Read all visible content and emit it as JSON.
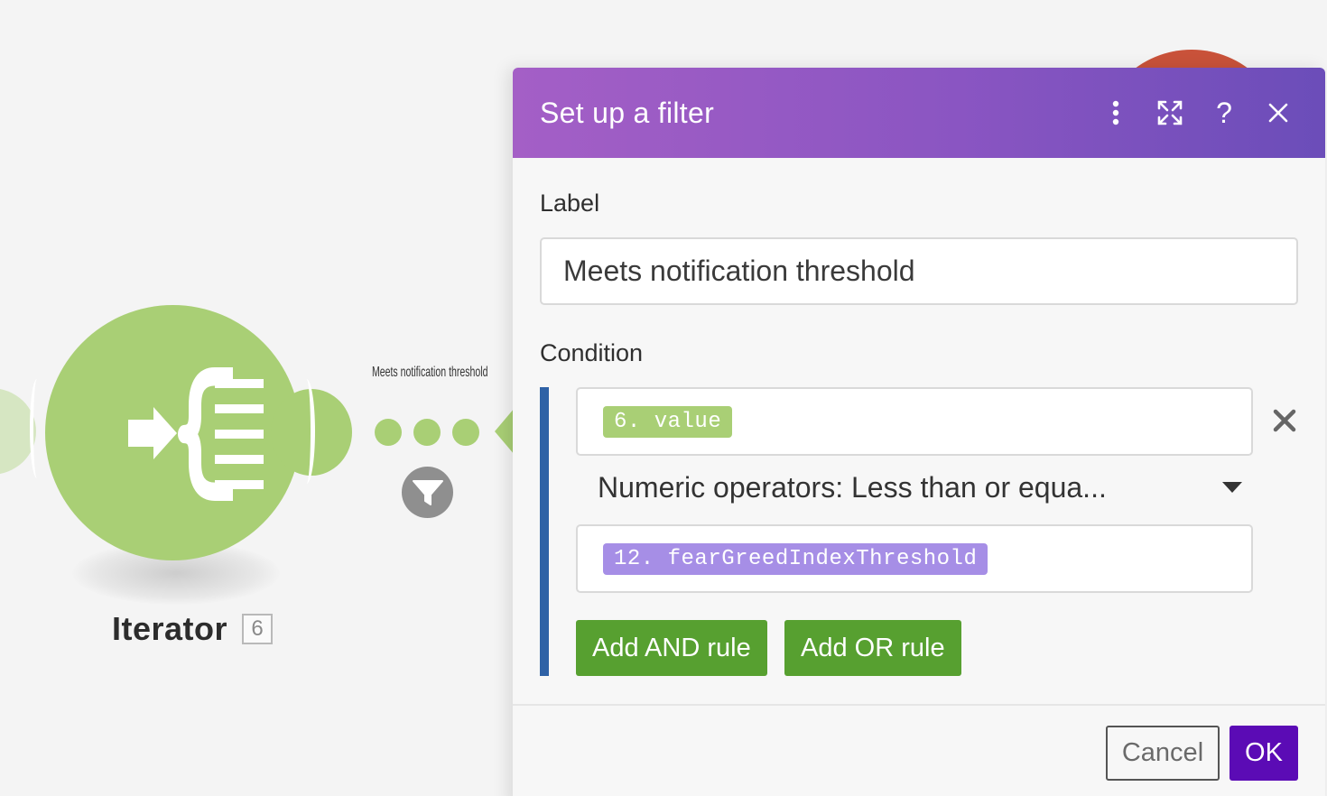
{
  "scenario": {
    "module": {
      "name": "Iterator",
      "id_badge": "6",
      "icon": "iterator-icon",
      "color": "#a9cf75"
    },
    "route": {
      "label": "Meets notification threshold",
      "filter_icon": "filter-funnel-icon"
    },
    "colors": {
      "canvas_bg": "#f4f4f4",
      "next_module": "#c9523a",
      "filter_bubble": "#8f8f8f"
    }
  },
  "dialog": {
    "title": "Set up a filter",
    "header_icons": [
      "more-vertical-icon",
      "expand-icon",
      "help-icon",
      "close-icon"
    ],
    "help_glyph": "?",
    "label_field": {
      "label": "Label",
      "value": "Meets notification threshold"
    },
    "condition": {
      "label": "Condition",
      "left_operand": "6. value",
      "operator": "Numeric operators: Less than or equa...",
      "right_operand": "12. fearGreedIndexThreshold",
      "remove_icon": "remove-rule-x-icon"
    },
    "buttons": {
      "add_and": "Add AND rule",
      "add_or": "Add OR rule",
      "cancel": "Cancel",
      "ok": "OK"
    },
    "colors": {
      "header_start": "#a45fc6",
      "header_end": "#6b4db9",
      "rule_button": "#57a030",
      "ok_button": "#5b0bb5",
      "condition_bar": "#2f62a6",
      "pill_module_6": "#a9cf75",
      "pill_module_12": "#a68ee6"
    }
  }
}
